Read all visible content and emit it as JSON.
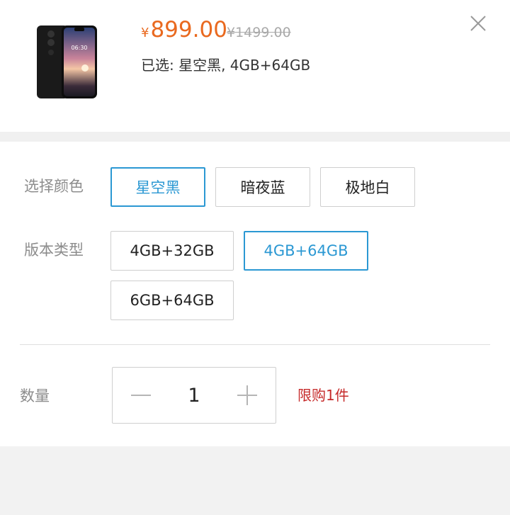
{
  "product": {
    "image_icon": "smartphone-thumbnail",
    "screen_time": "06:30",
    "price_symbol": "¥",
    "price": "899.00",
    "original_price": "¥1499.00",
    "selected_summary": "已选: 星空黑, 4GB+64GB"
  },
  "close_icon": "close-icon",
  "color": {
    "label": "选择颜色",
    "options": [
      "星空黑",
      "暗夜蓝",
      "极地白"
    ],
    "selected_index": 0
  },
  "version": {
    "label": "版本类型",
    "options": [
      "4GB+32GB",
      "4GB+64GB",
      "6GB+64GB"
    ],
    "selected_index": 1
  },
  "quantity": {
    "label": "数量",
    "value": "1",
    "minus_icon": "minus-icon",
    "plus_icon": "plus-icon",
    "limit_text": "限购1件"
  },
  "colors": {
    "price": "#e9691f",
    "accent": "#2b98d3",
    "limit": "#c62a2a"
  }
}
